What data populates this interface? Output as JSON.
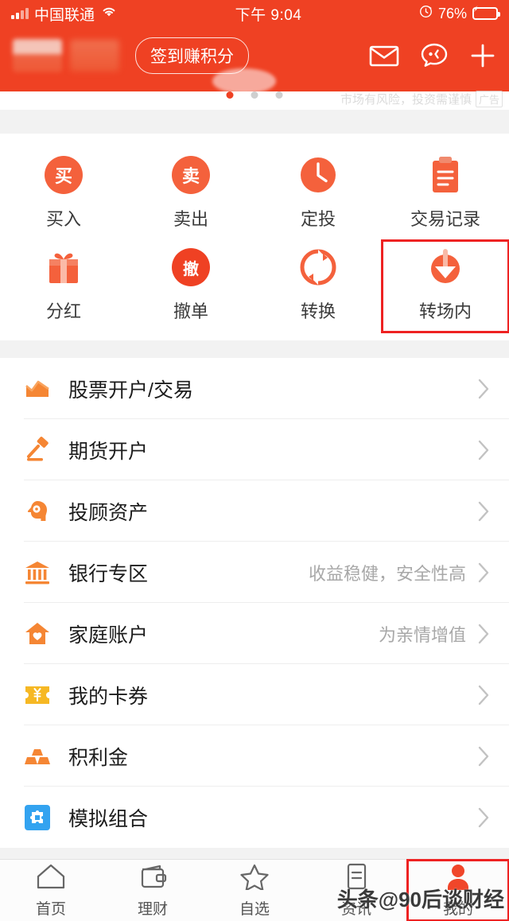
{
  "status_bar": {
    "carrier": "中国联通",
    "time": "下午 9:04",
    "battery_percent": "76%",
    "signal_icon": "signal-bars-icon",
    "wifi_icon": "wifi-icon",
    "alarm_icon": "alarm-clock-icon",
    "battery_icon": "battery-charging-icon"
  },
  "header": {
    "signin_label": "签到赚积分",
    "mail_icon": "mail-icon",
    "service_icon": "customer-service-icon",
    "add_icon": "plus-icon"
  },
  "banner": {
    "disclaimer": "市场有风险，投资需谨慎",
    "ad_tag": "广告",
    "dots_total": 3,
    "dot_active_index": 0
  },
  "quick_actions": {
    "rows": [
      [
        {
          "label": "买入",
          "icon": "buy-circle-icon",
          "glyph": "买",
          "style": "circle",
          "color": "#f4613c",
          "highlighted": false
        },
        {
          "label": "卖出",
          "icon": "sell-circle-icon",
          "glyph": "卖",
          "style": "circle",
          "color": "#f4613c",
          "highlighted": false
        },
        {
          "label": "定投",
          "icon": "clock-icon",
          "glyph": "",
          "style": "clock",
          "color": "#f4613c",
          "highlighted": false
        },
        {
          "label": "交易记录",
          "icon": "clipboard-icon",
          "glyph": "",
          "style": "clipboard",
          "color": "#f4613c",
          "highlighted": false
        }
      ],
      [
        {
          "label": "分红",
          "icon": "gift-icon",
          "glyph": "",
          "style": "gift",
          "color": "#f4613c",
          "highlighted": false
        },
        {
          "label": "撤单",
          "icon": "cancel-order-circle-icon",
          "glyph": "撤",
          "style": "circle",
          "color": "#ef4123",
          "highlighted": false
        },
        {
          "label": "转换",
          "icon": "convert-icon",
          "glyph": "",
          "style": "convert",
          "color": "#f4613c",
          "highlighted": false
        },
        {
          "label": "转场内",
          "icon": "transfer-in-icon",
          "glyph": "",
          "style": "download",
          "color": "#f4613c",
          "highlighted": true
        }
      ]
    ]
  },
  "menu_list": [
    {
      "label": "股票开户/交易",
      "sub": "",
      "icon": "stock-chart-icon",
      "color": "#f58634"
    },
    {
      "label": "期货开户",
      "sub": "",
      "icon": "gavel-icon",
      "color": "#f58634"
    },
    {
      "label": "投顾资产",
      "sub": "",
      "icon": "advisor-head-icon",
      "color": "#f58634"
    },
    {
      "label": "银行专区",
      "sub": "收益稳健，安全性高",
      "icon": "bank-icon",
      "color": "#f58634"
    },
    {
      "label": "家庭账户",
      "sub": "为亲情增值",
      "icon": "home-heart-icon",
      "color": "#f58634"
    },
    {
      "label": "我的卡券",
      "sub": "",
      "icon": "coupon-yen-icon",
      "color": "#f6b824"
    },
    {
      "label": "积利金",
      "sub": "",
      "icon": "gold-bars-icon",
      "color": "#f58634"
    },
    {
      "label": "模拟组合",
      "sub": "",
      "icon": "puzzle-icon",
      "color": "#33a3f0"
    }
  ],
  "tab_bar": {
    "tabs": [
      {
        "label": "首页",
        "icon": "home-icon",
        "active": false,
        "highlighted": false
      },
      {
        "label": "理财",
        "icon": "wallet-icon",
        "active": false,
        "highlighted": false
      },
      {
        "label": "自选",
        "icon": "star-icon",
        "active": false,
        "highlighted": false
      },
      {
        "label": "资讯",
        "icon": "news-icon",
        "active": false,
        "highlighted": false
      },
      {
        "label": "我的",
        "icon": "person-icon",
        "active": true,
        "highlighted": true
      }
    ]
  },
  "watermark": {
    "prefix": "头条",
    "handle": "@90后谈财经"
  },
  "colors": {
    "brand_red": "#ef4123",
    "accent_orange": "#f4613c",
    "icon_orange": "#f58634",
    "highlight_red": "#ee2222",
    "page_bg": "#f2f2f2"
  }
}
